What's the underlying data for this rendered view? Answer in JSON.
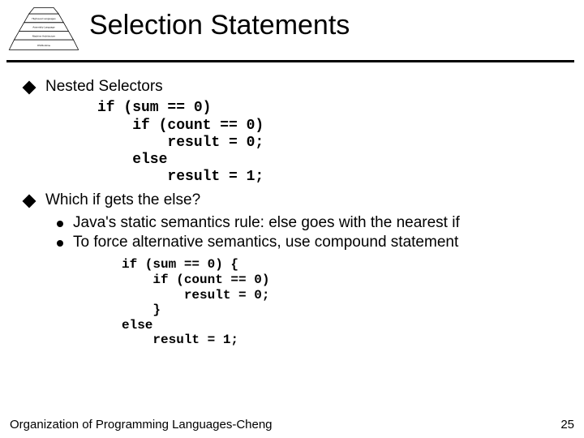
{
  "title": "Selection Statements",
  "bullets": {
    "b1": "Nested Selectors",
    "b2": "Which if gets the else?",
    "sub1": "Java's static semantics rule: else goes with the nearest if",
    "sub2": "To force alternative semantics, use compound statement"
  },
  "code1": "if (sum == 0)\n    if (count == 0)\n        result = 0;\n    else\n        result = 1;",
  "code2": "if (sum == 0) {\n    if (count == 0)\n        result = 0;\n    }\nelse\n    result = 1;",
  "footer": {
    "left": "Organization of Programming Languages-Cheng",
    "right": "25"
  },
  "icons": {
    "pyramid_layers": [
      "",
      "High-level Languages",
      "Assembly Language",
      "Machine Architecture",
      "OS/Runtime"
    ]
  }
}
